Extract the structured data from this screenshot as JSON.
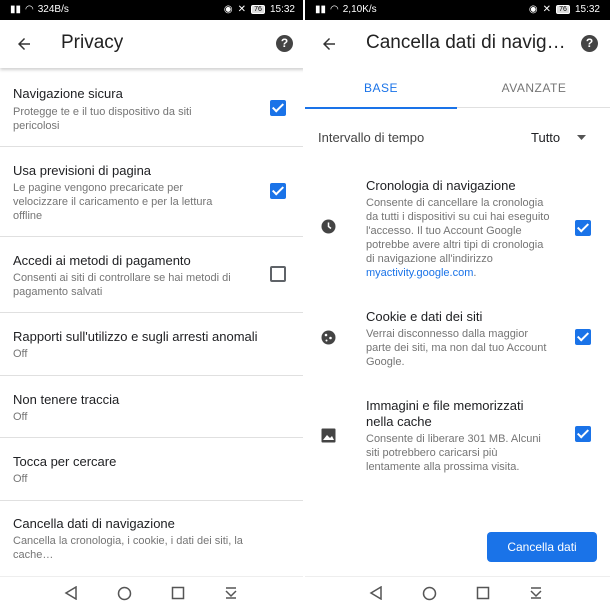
{
  "left": {
    "status": {
      "speed": "324B/s",
      "battery": "76",
      "time": "15:32"
    },
    "title": "Privacy",
    "help": "?",
    "items": [
      {
        "title": "Navigazione sicura",
        "sub": "Protegge te e il tuo dispositivo da siti pericolosi",
        "checked": true
      },
      {
        "title": "Usa previsioni di pagina",
        "sub": "Le pagine vengono precaricate per velocizzare il caricamento e per la lettura offline",
        "checked": true
      },
      {
        "title": "Accedi ai metodi di pagamento",
        "sub": "Consenti ai siti di controllare se hai metodi di pagamento salvati",
        "checked": false
      },
      {
        "title": "Rapporti sull'utilizzo e sugli arresti anomali",
        "sub": "Off"
      },
      {
        "title": "Non tenere traccia",
        "sub": "Off"
      },
      {
        "title": "Tocca per cercare",
        "sub": "Off"
      },
      {
        "title": "Cancella dati di navigazione",
        "sub": "Cancella la cronologia, i cookie, i dati dei siti, la cache…"
      }
    ]
  },
  "right": {
    "status": {
      "speed": "2,10K/s",
      "battery": "76",
      "time": "15:32"
    },
    "title": "Cancella dati di navig…",
    "help": "?",
    "tabs": [
      "BASE",
      "AVANZATE"
    ],
    "interval": {
      "label": "Intervallo di tempo",
      "value": "Tutto"
    },
    "items": [
      {
        "title": "Cronologia di navigazione",
        "desc": "Consente di cancellare la cronologia da tutti i dispositivi su cui hai eseguito l'accesso. Il tuo Account Google potrebbe avere altri tipi di cronologia di navigazione all'indirizzo",
        "link": "myactivity.google.com",
        "after": ".",
        "icon": "history-icon",
        "checked": true
      },
      {
        "title": "Cookie e dati dei siti",
        "desc": "Verrai disconnesso dalla maggior parte dei siti, ma non dal tuo Account Google.",
        "icon": "cookie-icon",
        "checked": true
      },
      {
        "title": "Immagini e file memorizzati nella cache",
        "desc": "Consente di liberare 301 MB. Alcuni siti potrebbero caricarsi più lentamente alla prossima visita.",
        "icon": "image-icon",
        "checked": true
      }
    ],
    "button": "Cancella dati"
  },
  "colors": {
    "accent": "#1a73e8",
    "status_bar": "#000000"
  }
}
